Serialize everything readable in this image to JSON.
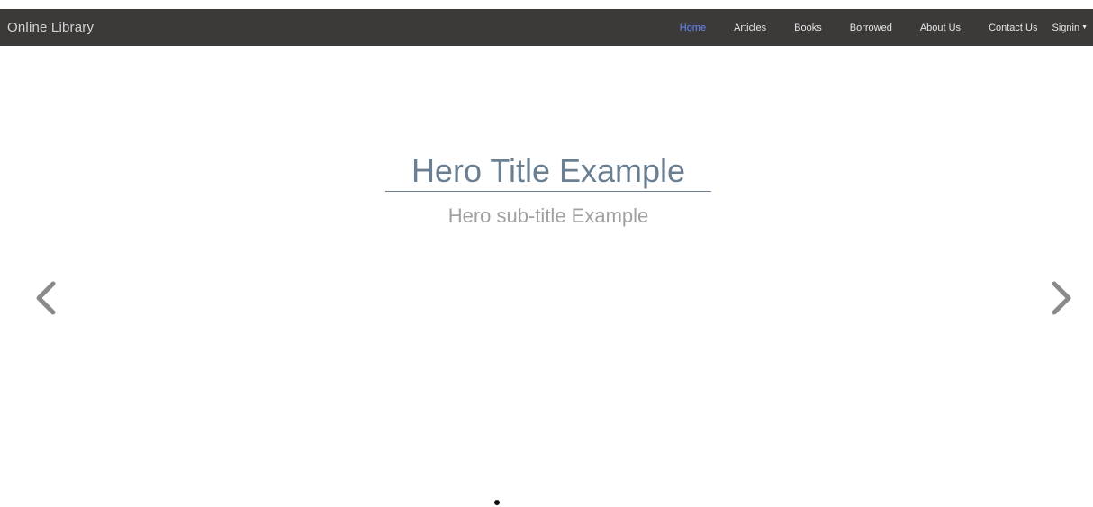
{
  "navbar": {
    "brand": "Online Library",
    "links": [
      {
        "label": "Home",
        "active": true
      },
      {
        "label": "Articles"
      },
      {
        "label": "Books"
      },
      {
        "label": "Borrowed"
      },
      {
        "label": "About Us"
      },
      {
        "label": "Contact Us"
      }
    ],
    "signin_label": "Signin",
    "signin_icon": "chevron-down-icon"
  },
  "hero": {
    "title": "Hero Title Example",
    "subtitle": "Hero sub-title Example"
  },
  "carousel": {
    "prev_icon": "chevron-left-icon",
    "next_icon": "chevron-right-icon"
  },
  "colors": {
    "navbar_bg": "#3b3a39",
    "active_link": "#6a86ff",
    "title": "#6a7f92",
    "subtitle": "#a0a0a0",
    "arrow": "#8a8a8a"
  }
}
